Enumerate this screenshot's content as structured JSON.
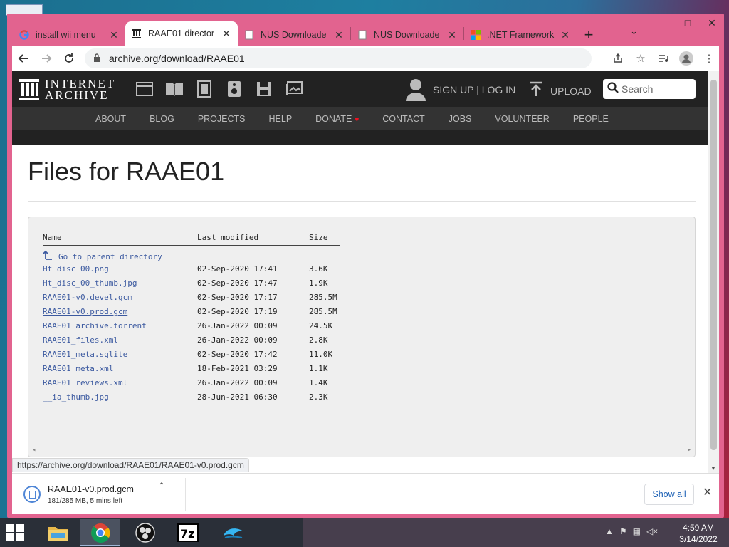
{
  "browser": {
    "tabs": [
      {
        "title": "install wii menu",
        "icon": "google-icon",
        "active": false
      },
      {
        "title": "RAAE01 director",
        "icon": "archive-icon",
        "active": true
      },
      {
        "title": "NUS Downloade",
        "icon": "page-icon",
        "active": false
      },
      {
        "title": "NUS Downloade",
        "icon": "page-icon",
        "active": false
      },
      {
        "title": ".NET Framework",
        "icon": "windows-icon",
        "active": false
      }
    ],
    "new_tab": "+",
    "tab_list": "⌄",
    "window_controls": {
      "minimize": "—",
      "maximize": "□",
      "close": "✕"
    },
    "url": "archive.org/download/RAAE01",
    "status_url": "https://archive.org/download/RAAE01/RAAE01-v0.prod.gcm"
  },
  "site": {
    "logo_line1": "INTERNET",
    "logo_line2": "ARCHIVE",
    "auth": "SIGN UP | LOG IN",
    "upload": "UPLOAD",
    "search_placeholder": "Search",
    "nav": [
      "ABOUT",
      "BLOG",
      "PROJECTS",
      "HELP",
      "DONATE",
      "CONTACT",
      "JOBS",
      "VOLUNTEER",
      "PEOPLE"
    ]
  },
  "page": {
    "title": "Files for RAAE01",
    "columns": {
      "name": "Name",
      "modified": "Last modified",
      "size": "Size"
    },
    "parent_link": "Go to parent directory",
    "files": [
      {
        "name": "Ht_disc_00.png",
        "modified": "02-Sep-2020 17:41",
        "size": "3.6K"
      },
      {
        "name": "Ht_disc_00_thumb.jpg",
        "modified": "02-Sep-2020 17:47",
        "size": "1.9K"
      },
      {
        "name": "RAAE01-v0.devel.gcm",
        "modified": "02-Sep-2020 17:17",
        "size": "285.5M"
      },
      {
        "name": "RAAE01-v0.prod.gcm",
        "modified": "02-Sep-2020 17:19",
        "size": "285.5M"
      },
      {
        "name": "RAAE01_archive.torrent",
        "modified": "26-Jan-2022 00:09",
        "size": "24.5K"
      },
      {
        "name": "RAAE01_files.xml",
        "modified": "26-Jan-2022 00:09",
        "size": "2.8K"
      },
      {
        "name": "RAAE01_meta.sqlite",
        "modified": "02-Sep-2020 17:42",
        "size": "11.0K"
      },
      {
        "name": "RAAE01_meta.xml",
        "modified": "18-Feb-2021 03:29",
        "size": "1.1K"
      },
      {
        "name": "RAAE01_reviews.xml",
        "modified": "26-Jan-2022 00:09",
        "size": "1.4K"
      },
      {
        "name": "__ia_thumb.jpg",
        "modified": "28-Jun-2021 06:30",
        "size": "2.3K"
      }
    ]
  },
  "download": {
    "filename": "RAAE01-v0.prod.gcm",
    "progress_text": "181/285 MB, 5 mins left",
    "show_all": "Show all"
  },
  "taskbar": {
    "apps": [
      "file-explorer-icon",
      "chrome-icon",
      "obs-icon",
      "7zip-icon",
      "dolphin-icon"
    ],
    "time": "4:59 AM",
    "date": "3/14/2022"
  },
  "colors": {
    "window_frame": "#e2638f",
    "link": "#3c5aa0",
    "ia_header": "#222222"
  }
}
